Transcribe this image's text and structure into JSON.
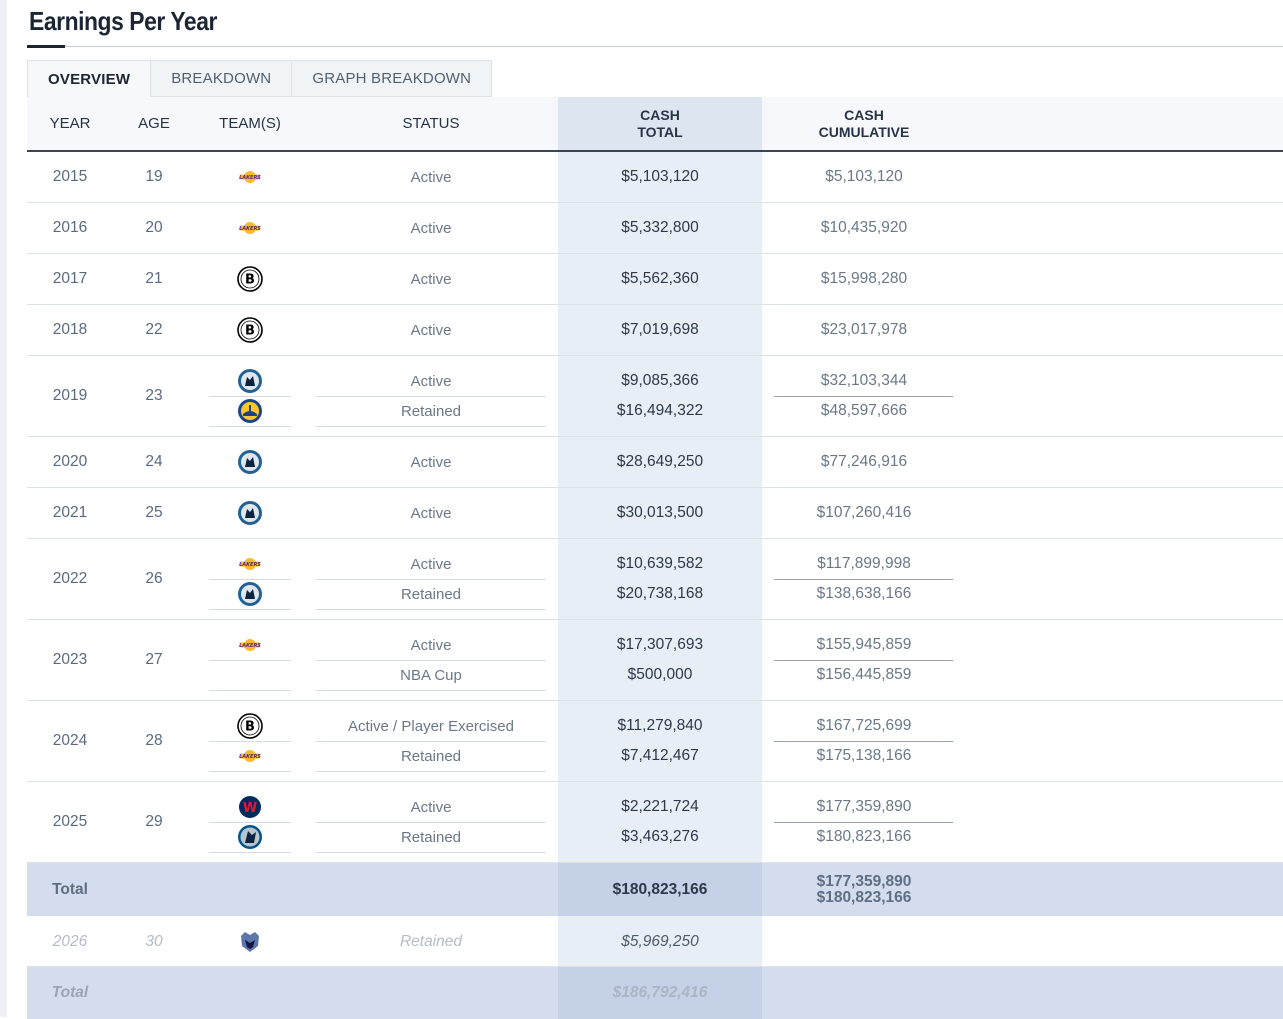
{
  "page": {
    "title": "Earnings Per Year"
  },
  "tabs": [
    {
      "label": "OVERVIEW",
      "active": true
    },
    {
      "label": "BREAKDOWN",
      "active": false
    },
    {
      "label": "GRAPH BREAKDOWN",
      "active": false
    }
  ],
  "header": {
    "year": "YEAR",
    "age": "AGE",
    "teams": "TEAM(S)",
    "status": "STATUS",
    "cash_total_1": "CASH",
    "cash_total_2": "TOTAL",
    "cash_cum_1": "CASH",
    "cash_cum_2": "CUMULATIVE"
  },
  "rows": [
    {
      "year": "2015",
      "age": "19",
      "entries": [
        {
          "team": "lakers-logo",
          "status": "Active",
          "cash": "$5,103,120",
          "cumulative": "$5,103,120"
        }
      ]
    },
    {
      "year": "2016",
      "age": "20",
      "entries": [
        {
          "team": "lakers-logo",
          "status": "Active",
          "cash": "$5,332,800",
          "cumulative": "$10,435,920"
        }
      ]
    },
    {
      "year": "2017",
      "age": "21",
      "entries": [
        {
          "team": "nets-logo",
          "status": "Active",
          "cash": "$5,562,360",
          "cumulative": "$15,998,280"
        }
      ]
    },
    {
      "year": "2018",
      "age": "22",
      "entries": [
        {
          "team": "nets-logo",
          "status": "Active",
          "cash": "$7,019,698",
          "cumulative": "$23,017,978"
        }
      ]
    },
    {
      "year": "2019",
      "age": "23",
      "entries": [
        {
          "team": "timberwolves-logo",
          "status": "Active",
          "cash": "$9,085,366",
          "cumulative": "$32,103,344"
        },
        {
          "team": "warriors-logo",
          "status": "Retained",
          "cash": "$16,494,322",
          "cumulative": "$48,597,666"
        }
      ]
    },
    {
      "year": "2020",
      "age": "24",
      "entries": [
        {
          "team": "timberwolves-logo",
          "status": "Active",
          "cash": "$28,649,250",
          "cumulative": "$77,246,916"
        }
      ]
    },
    {
      "year": "2021",
      "age": "25",
      "entries": [
        {
          "team": "timberwolves-logo",
          "status": "Active",
          "cash": "$30,013,500",
          "cumulative": "$107,260,416"
        }
      ]
    },
    {
      "year": "2022",
      "age": "26",
      "entries": [
        {
          "team": "lakers-logo",
          "status": "Active",
          "cash": "$10,639,582",
          "cumulative": "$117,899,998"
        },
        {
          "team": "timberwolves-logo",
          "status": "Retained",
          "cash": "$20,738,168",
          "cumulative": "$138,638,166"
        }
      ]
    },
    {
      "year": "2023",
      "age": "27",
      "entries": [
        {
          "team": "lakers-logo",
          "status": "Active",
          "cash": "$17,307,693",
          "cumulative": "$155,945,859"
        },
        {
          "team": "",
          "status": "NBA Cup",
          "cash": "$500,000",
          "cumulative": "$156,445,859"
        }
      ]
    },
    {
      "year": "2024",
      "age": "28",
      "entries": [
        {
          "team": "nets-logo",
          "status": "Active / Player Exercised",
          "cash": "$11,279,840",
          "cumulative": "$167,725,699"
        },
        {
          "team": "lakers-logo",
          "status": "Retained",
          "cash": "$7,412,467",
          "cumulative": "$175,138,166"
        }
      ]
    },
    {
      "year": "2025",
      "age": "29",
      "entries": [
        {
          "team": "wizards-logo",
          "status": "Active",
          "cash": "$2,221,724",
          "cumulative": "$177,359,890"
        },
        {
          "team": "mavericks-logo",
          "status": "Retained",
          "cash": "$3,463,276",
          "cumulative": "$180,823,166"
        }
      ]
    }
  ],
  "total": {
    "label": "Total",
    "cash": "$180,823,166",
    "cumulative_1": "$177,359,890",
    "cumulative_2": "$180,823,166"
  },
  "future": {
    "year": "2026",
    "age": "30",
    "team": "grizzlies-logo",
    "status": "Retained",
    "cash": "$5,969,250"
  },
  "future_total": {
    "label": "Total",
    "cash": "$186,792,416"
  },
  "colors": {
    "lakers": "#552583",
    "lakers_gold": "#FDB927",
    "nets": "#000000",
    "timberwolves": "#0C2340",
    "timberwolves_blue": "#236192",
    "warriors": "#1D428A",
    "warriors_gold": "#FFC72C",
    "wizards": "#002B5C",
    "wizards_red": "#E31837",
    "mavericks": "#00538C",
    "grizzlies": "#5D76A9"
  }
}
